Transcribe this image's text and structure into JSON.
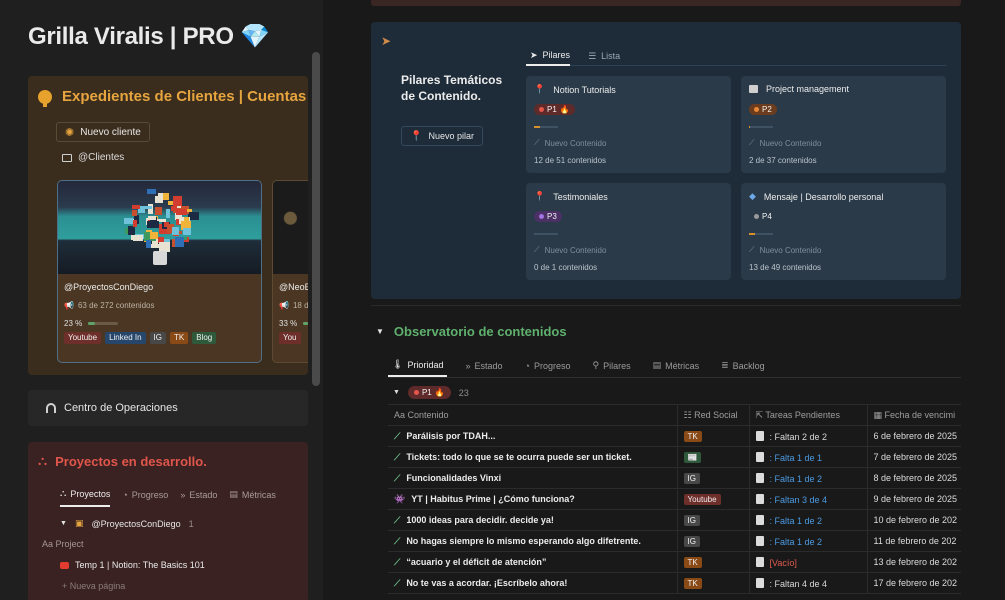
{
  "page": {
    "title": "Grilla Viralis | PRO",
    "title_icon": "gem-icon"
  },
  "clients": {
    "heading": "Expedientes de Clientes | Cuentas",
    "new_button": "Nuevo cliente",
    "db_link": "@Clientes",
    "cards": [
      {
        "name": "@ProyectosConDiego",
        "count": "63 de 272 contenidos",
        "pct": "23 %",
        "progress": 0.23,
        "tags": [
          {
            "label": "Youtube",
            "color": "red"
          },
          {
            "label": "Linked In",
            "color": "blue"
          },
          {
            "label": "IG",
            "color": "gray"
          },
          {
            "label": "TK",
            "color": "orange"
          },
          {
            "label": "Blog",
            "color": "green"
          }
        ]
      },
      {
        "name": "@NeoB",
        "count": "18 d",
        "pct": "33 %",
        "progress": 0.33,
        "tags": [
          {
            "label": "You",
            "color": "red"
          }
        ]
      }
    ]
  },
  "ops": {
    "label": "Centro de Operaciones"
  },
  "projects": {
    "heading": "Proyectos en desarrollo.",
    "tabs": [
      "Proyectos",
      "Progreso",
      "Estado",
      "Métricas"
    ],
    "group": "@ProyectosConDiego",
    "group_count": "1",
    "column": "Project",
    "row": "Temp 1 | Notion: The Basics 101",
    "new_page": "Nueva página"
  },
  "pillars": {
    "heading": "Pilares Temáticos de Contenido.",
    "new_button": "Nuevo pilar",
    "tabs": [
      "Pilares",
      "Lista"
    ],
    "cards": [
      {
        "title": "Notion Tutorials",
        "prio": "P1",
        "prio_class": "p1",
        "fire": "🔥",
        "progress": 0.24,
        "new": "Nuevo Contenido",
        "count": "12 de 51 contenidos"
      },
      {
        "title": "Project management",
        "prio": "P2",
        "prio_class": "p2",
        "fire": "",
        "progress": 0.05,
        "new": "Nuevo Contenido",
        "count": "2 de 37 contenidos"
      },
      {
        "title": "Testimoniales",
        "prio": "P3",
        "prio_class": "p3",
        "fire": "",
        "progress": 0.0,
        "new": "Nuevo Contenido",
        "count": "0 de 1 contenidos"
      },
      {
        "title": "Mensaje | Desarrollo personal",
        "prio": "P4",
        "prio_class": "p4",
        "fire": "",
        "progress": 0.27,
        "new": "Nuevo Contenido",
        "count": "13 de 49 contenidos"
      }
    ]
  },
  "observatory": {
    "heading": "Observatorio de contenidos",
    "tabs": [
      "Prioridad",
      "Estado",
      "Progreso",
      "Pilares",
      "Métricas",
      "Backlog"
    ],
    "group_label": "P1",
    "group_count": "23",
    "columns": [
      "Contenido",
      "Red Social",
      "Tareas Pendientes",
      "Fecha de vencimi"
    ],
    "rows": [
      {
        "content": "Parálisis por TDAH...",
        "icon": "green",
        "network": "TK",
        "net_color": "orange",
        "task": ": Faltan 2 de 2",
        "task_style": "",
        "date": "6 de febrero de 2025"
      },
      {
        "content": "Tickets: todo lo que se te ocurra puede ser un ticket.",
        "icon": "green",
        "network": "📰",
        "net_color": "green",
        "task": ": Falta 1 de 1",
        "task_style": "link",
        "date": "7 de febrero de 2025"
      },
      {
        "content": "Funcionalidades Vinxi",
        "icon": "green",
        "network": "IG",
        "net_color": "gray",
        "task": ": Falta 1 de 2",
        "task_style": "link",
        "date": "8 de febrero de 2025"
      },
      {
        "content": "YT | Habitus Prime | ¿Cómo funciona?",
        "icon": "purple",
        "network": "Youtube",
        "net_color": "red",
        "task": ": Faltan 3 de 4",
        "task_style": "link",
        "date": "9 de febrero de 2025"
      },
      {
        "content": "1000 ideas para decidir. decide ya!",
        "icon": "green",
        "network": "IG",
        "net_color": "gray",
        "task": ": Falta 1 de 2",
        "task_style": "link",
        "date": "10 de febrero de 202"
      },
      {
        "content": "No hagas siempre lo mismo esperando algo difetrente.",
        "icon": "green",
        "network": "IG",
        "net_color": "gray",
        "task": ": Falta 1 de 2",
        "task_style": "link",
        "date": "11 de febrero de 202"
      },
      {
        "content": "“acuario y el déficit de atención”",
        "icon": "green",
        "network": "TK",
        "net_color": "orange",
        "task": "[Vacío]",
        "task_style": "empty",
        "date": "13 de febrero de 202"
      },
      {
        "content": "No te vas a acordar. ¡Escríbelo ahora!",
        "icon": "green",
        "network": "TK",
        "net_color": "orange",
        "task": ": Faltan 4 de 4",
        "task_style": "",
        "date": "17 de febrero de 202"
      }
    ]
  },
  "colors": {
    "clients_accent": "#e6a53f",
    "projects_accent": "#e0564b",
    "observatory_accent": "#5fb06d",
    "link_blue": "#4b9be3"
  }
}
